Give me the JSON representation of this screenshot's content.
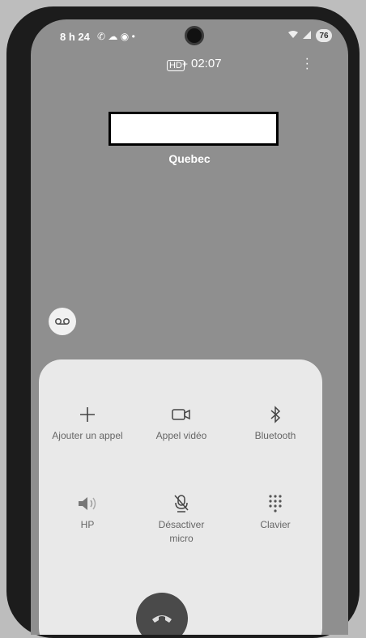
{
  "status_bar": {
    "time": "8 h 24",
    "battery": "76"
  },
  "call": {
    "hd_label": "HD",
    "hd_plus": "+",
    "timer": "02:07",
    "location": "Quebec"
  },
  "actions": [
    {
      "label": "Ajouter un appel",
      "icon": "plus-icon"
    },
    {
      "label": "Appel vidéo",
      "icon": "video-camera-icon"
    },
    {
      "label": "Bluetooth",
      "icon": "bluetooth-icon"
    },
    {
      "label": "HP",
      "icon": "speaker-icon"
    },
    {
      "label": "Désactiver\nmicro",
      "icon": "mic-off-icon"
    },
    {
      "label": "Clavier",
      "icon": "keypad-icon"
    }
  ]
}
